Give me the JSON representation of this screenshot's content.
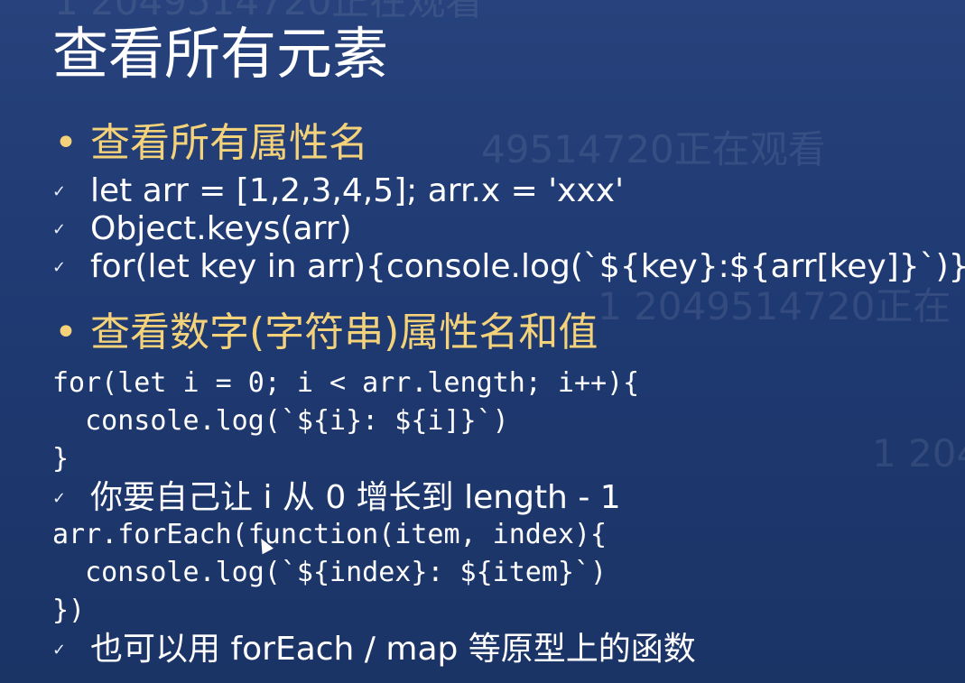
{
  "watermark": {
    "top": "1 2049514720正在观看",
    "a": "49514720正在观看",
    "b": "1 2049514720正在",
    "c": "1 204"
  },
  "slide": {
    "title": "查看所有元素",
    "section1": {
      "bullet": "•",
      "heading": "查看所有属性名",
      "checks": [
        "let arr = [1,2,3,4,5]; arr.x = 'xxx'",
        "Object.keys(arr)",
        "for(let key in arr){console.log(`${key}:${arr[key]}`)}"
      ]
    },
    "section2": {
      "bullet": "•",
      "heading": "查看数字(字符串)属性名和值",
      "code1": [
        "for(let i = 0; i < arr.length; i++){",
        "  console.log(`${i}: ${i]}`)",
        "}"
      ],
      "note1": "你要自己让 i 从 0 增长到 length - 1",
      "code2": [
        "arr.forEach(function(item, index){",
        "  console.log(`${index}: ${item}`)",
        "})"
      ],
      "note2": "也可以用 forEach / map 等原型上的函数"
    },
    "check_mark": "✓"
  }
}
